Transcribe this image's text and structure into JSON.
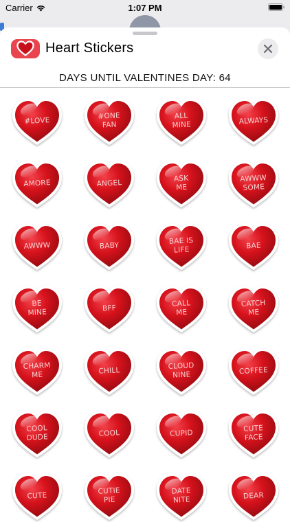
{
  "status_bar": {
    "carrier": "Carrier",
    "time": "1:07 PM"
  },
  "header": {
    "title": "Heart Stickers",
    "app_icon": "heart-icon",
    "close_icon": "close-icon"
  },
  "countdown": "DAYS UNTIL VALENTINES DAY: 64",
  "colors": {
    "heart_red": "#d6121c",
    "heart_dark": "#8f0a10",
    "sticker_text": "#f7d3d3",
    "icon_bg": "#e8454f"
  },
  "stickers": [
    "#LOVE",
    "#ONE\nFAN",
    "ALL\nMINE",
    "ALWAYS",
    "AMORE",
    "ANGEL",
    "ASK\nME",
    "AWWW\nSOME",
    "AWWW",
    "BABY",
    "BAE IS\nLIFE",
    "BAE",
    "BE\nMINE",
    "BFF",
    "CALL\nME",
    "CATCH\nME",
    "CHARM\nME",
    "CHILL",
    "CLOUD\nNINE",
    "COFFEE",
    "COOL\nDUDE",
    "COOL",
    "CUPID",
    "CUTE\nFACE",
    "CUTE",
    "CUTIE\nPIE",
    "DATE\nNITE",
    "DEAR"
  ]
}
